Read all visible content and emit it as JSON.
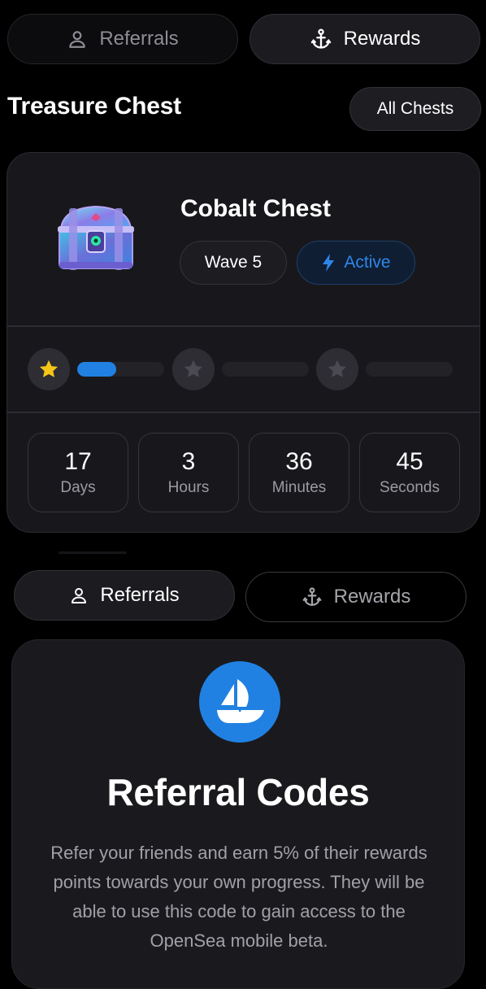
{
  "top_tabs": [
    {
      "label": "Referrals",
      "icon": "person-icon"
    },
    {
      "label": "Rewards",
      "icon": "anchor-icon"
    }
  ],
  "section": {
    "title": "Treasure Chest",
    "all_chests_label": "All Chests"
  },
  "chest_card": {
    "image_icon": "treasure-chest-icon",
    "name": "Cobalt Chest",
    "wave_label": "Wave 5",
    "status_label": "Active",
    "status_icon": "lightning-bolt-icon",
    "progress": {
      "stars": [
        {
          "state": "earned",
          "color": "#f5c518"
        },
        {
          "state": "locked",
          "color": "#4a4a52"
        },
        {
          "state": "locked",
          "color": "#4a4a52"
        }
      ],
      "segments": [
        0.45,
        0,
        0
      ]
    },
    "countdown": [
      {
        "value": "17",
        "unit": "Days"
      },
      {
        "value": "3",
        "unit": "Hours"
      },
      {
        "value": "36",
        "unit": "Minutes"
      },
      {
        "value": "45",
        "unit": "Seconds"
      }
    ]
  },
  "bottom_tabs": [
    {
      "label": "Referrals",
      "icon": "person-icon"
    },
    {
      "label": "Rewards",
      "icon": "anchor-icon"
    }
  ],
  "referral": {
    "logo_icon": "opensea-logo-icon",
    "title": "Referral Codes",
    "body": "Refer your friends and earn 5% of their rewards points towards your own progress. They will be able to use this code to gain access to the OpenSea mobile beta."
  },
  "colors": {
    "background": "#000000",
    "card": "#18181c",
    "accent_blue": "#2081e2",
    "star_gold": "#f5c518",
    "muted_text": "#9a9aa2"
  }
}
